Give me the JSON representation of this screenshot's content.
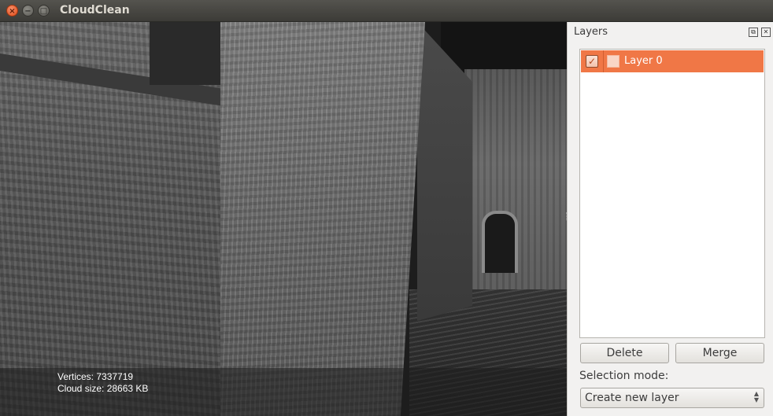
{
  "window": {
    "title": "CloudClean",
    "close_glyph": "×",
    "minimize_glyph": "−",
    "maximize_glyph": "□"
  },
  "viewport": {
    "stats": {
      "vertices": "Vertices: 7337719",
      "cloud_size": "Cloud size: 28663 KB"
    }
  },
  "layers_panel": {
    "title": "Layers",
    "float_icon": "float-icon",
    "close_icon": "close-icon",
    "layers": [
      {
        "name": "Layer 0",
        "visible": true,
        "selected": true,
        "color": "#f9d6c6"
      }
    ],
    "delete_label": "Delete",
    "merge_label": "Merge",
    "selection_mode_label": "Selection mode:",
    "selection_mode_value": "Create new layer"
  },
  "colors": {
    "accent": "#f07746",
    "titlebar": "#3c3b37",
    "panel_bg": "#f2f1f0"
  }
}
